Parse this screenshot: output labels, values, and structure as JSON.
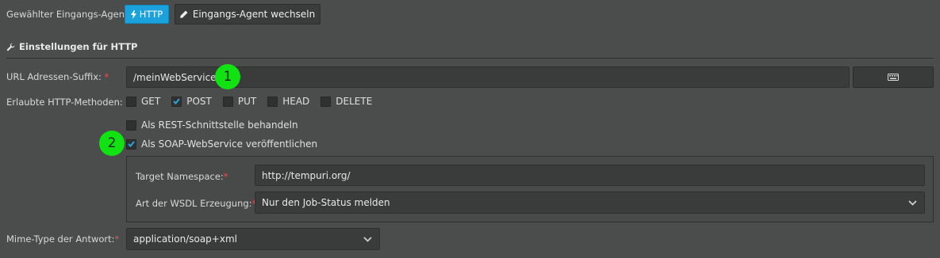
{
  "header": {
    "agent_label": "Gewählter Eingangs-Agent:",
    "agent_value": "HTTP",
    "switch_button": "Eingangs-Agent wechseln"
  },
  "section": {
    "title": "Einstellungen für HTTP"
  },
  "url_suffix": {
    "label": "URL Adressen-Suffix:",
    "required": "*",
    "value": "/meinWebService"
  },
  "methods": {
    "label": "Erlaubte HTTP-Methoden:",
    "items": [
      {
        "label": "GET",
        "checked": false
      },
      {
        "label": "POST",
        "checked": true
      },
      {
        "label": "PUT",
        "checked": false
      },
      {
        "label": "HEAD",
        "checked": false
      },
      {
        "label": "DELETE",
        "checked": false
      }
    ]
  },
  "rest_option": {
    "label": "Als REST-Schnittstelle behandeln",
    "checked": false
  },
  "soap_option": {
    "label": "Als SOAP-WebService veröffentlichen",
    "checked": true
  },
  "soap": {
    "namespace_label": "Target Namespace:",
    "namespace_value": "http://tempuri.org/",
    "wsdl_label": "Art der WSDL Erzeugung:",
    "wsdl_value": "Nur den Job-Status melden",
    "required": "*"
  },
  "mime": {
    "label": "Mime-Type der Antwort:",
    "value": "application/soap+xml",
    "required": "*"
  },
  "markers": {
    "one": "1",
    "two": "2"
  },
  "colors": {
    "accent": "#1ba1dc",
    "marker": "#11e211",
    "required": "#e05353"
  },
  "icons": {
    "agent": "bolt-icon",
    "switch": "pencil-icon",
    "section": "wrench-icon",
    "url_button": "keyboard-icon",
    "checkbox": "check-icon",
    "select": "chevron-down-icon"
  }
}
